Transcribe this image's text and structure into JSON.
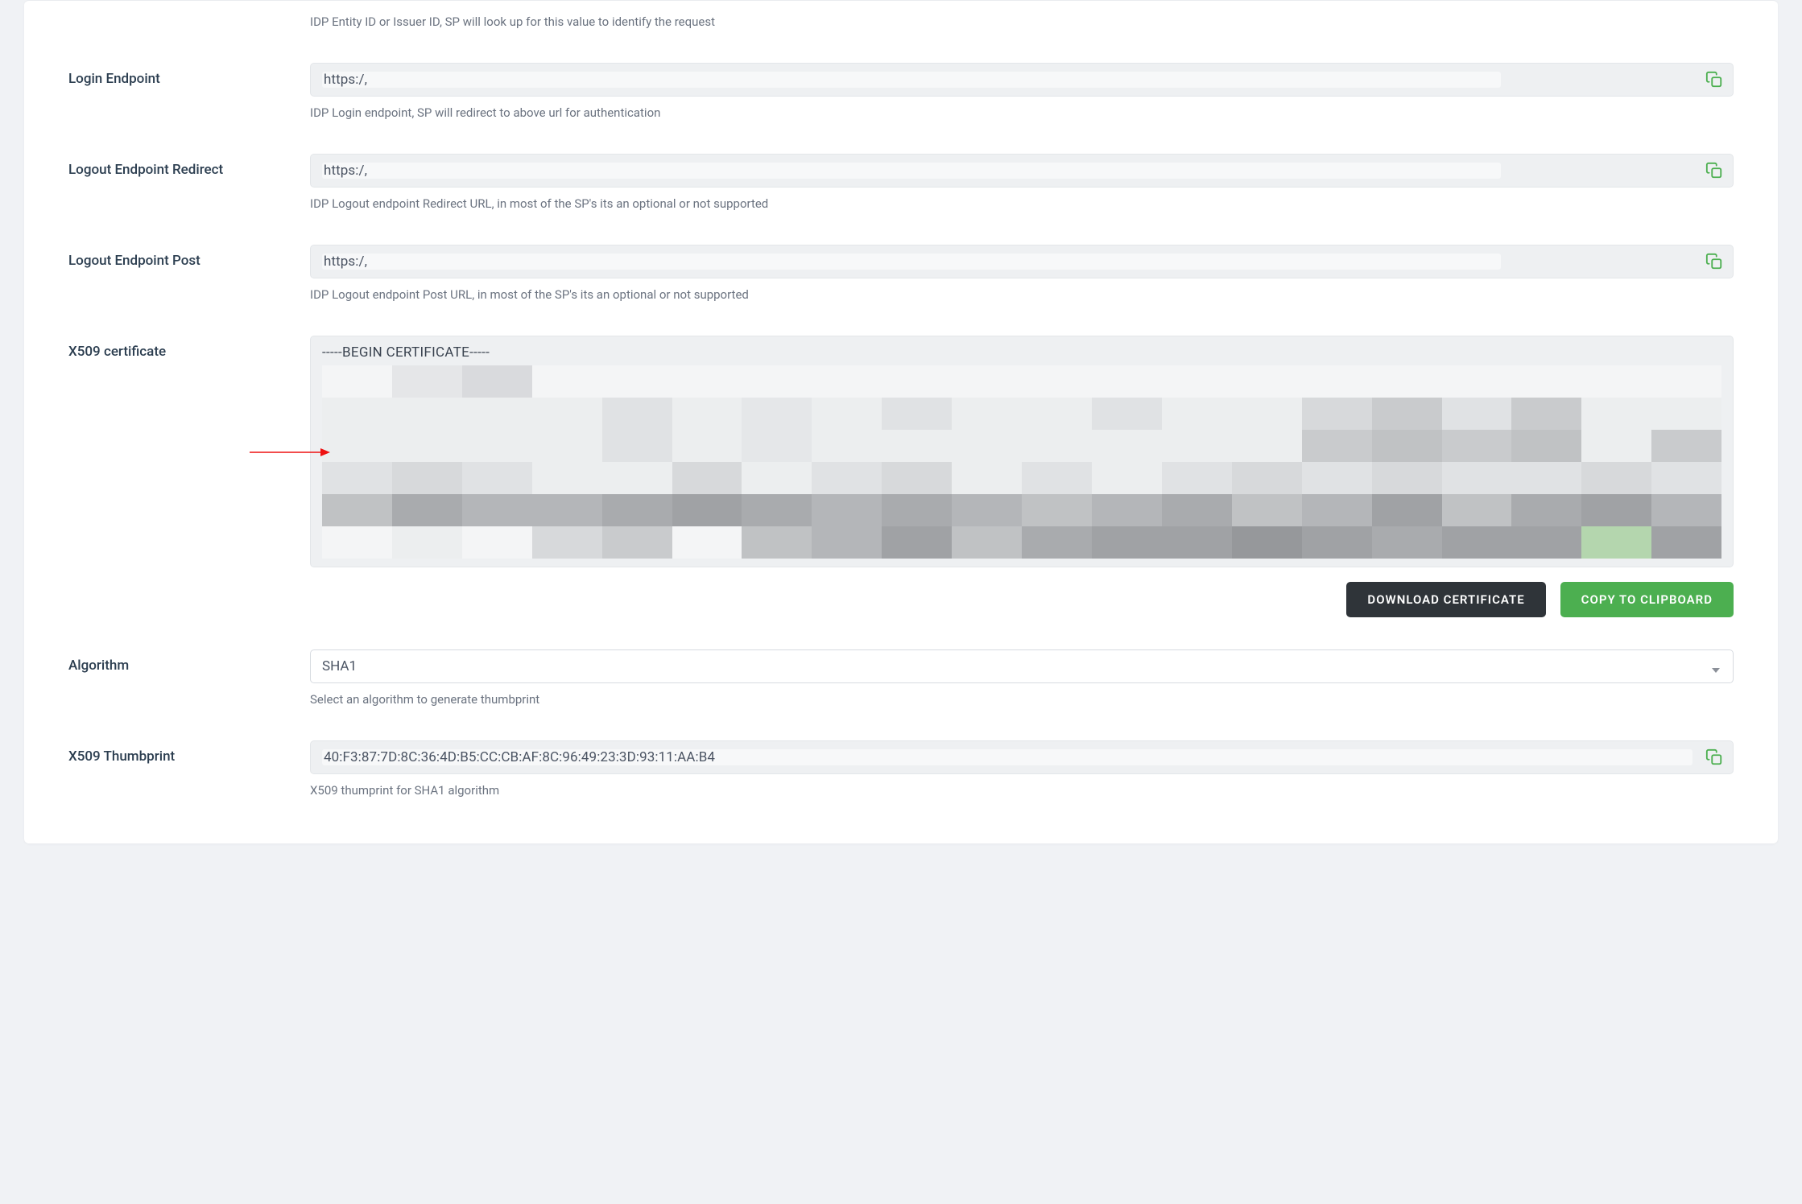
{
  "fields": {
    "entity_id": {
      "help": "IDP Entity ID or Issuer ID, SP will look up for this value to identify the request"
    },
    "login_endpoint": {
      "label": "Login Endpoint",
      "value": "https:/,",
      "help": "IDP Login endpoint, SP will redirect to above url for authentication"
    },
    "logout_redirect": {
      "label": "Logout Endpoint Redirect",
      "value": "https:/,",
      "help": "IDP Logout endpoint Redirect URL, in most of the SP's its an optional or not supported"
    },
    "logout_post": {
      "label": "Logout Endpoint Post",
      "value": "https:/,",
      "help": "IDP Logout endpoint Post URL, in most of the SP's its an optional or not supported"
    },
    "x509_cert": {
      "label": "X509 certificate",
      "header": "-----BEGIN CERTIFICATE-----"
    },
    "algorithm": {
      "label": "Algorithm",
      "value": "SHA1",
      "help": "Select an algorithm to generate thumbprint"
    },
    "x509_thumb": {
      "label": "X509 Thumbprint",
      "value": "40:F3:87:7D:8C:36:4D:B5:CC:CB:AF:8C:96:49:23:3D:93:11:AA:B4",
      "help": "X509 thumprint for SHA1 algorithm"
    }
  },
  "buttons": {
    "download_cert": "DOWNLOAD CERTIFICATE",
    "copy_clipboard": "COPY TO CLIPBOARD"
  },
  "pixel_rows": [
    [
      "#f4f5f6",
      "#e5e6e8",
      "#d9dadd",
      "#f4f5f6",
      "#f4f5f6",
      "#f4f5f6",
      "#f4f5f6",
      "#f4f5f6",
      "#f4f5f6",
      "#f4f5f6",
      "#f4f5f6",
      "#f4f5f6",
      "#f4f5f6",
      "#f4f5f6",
      "#f4f5f6",
      "#f4f5f6",
      "#f4f5f6",
      "#f4f5f6",
      "#f4f5f6",
      "#f4f5f6"
    ],
    [
      "#eceeef",
      "#eceeef",
      "#eceeef",
      "#eceeef",
      "#e0e2e4",
      "#eceeef",
      "#e5e7e9",
      "#eceeef",
      "#e0e2e4",
      "#eceeef",
      "#eceeef",
      "#e0e2e4",
      "#eceeef",
      "#eceeef",
      "#d7d9db",
      "#c9cbcd",
      "#e0e2e4",
      "#c9cbcd",
      "#eceeef",
      "#eceeef"
    ],
    [
      "#eceeef",
      "#eceeef",
      "#eceeef",
      "#eceeef",
      "#e0e2e4",
      "#eceeef",
      "#e5e7e9",
      "#eceeef",
      "#eceeef",
      "#eceeef",
      "#eceeef",
      "#eceeef",
      "#eceeef",
      "#eceeef",
      "#c9cbcd",
      "#c0c2c4",
      "#c9cbcd",
      "#c0c2c4",
      "#eceeef",
      "#c9cbcd"
    ],
    [
      "#e0e2e4",
      "#d7d9db",
      "#e0e2e4",
      "#eceeef",
      "#eceeef",
      "#d7d9db",
      "#eceeef",
      "#e0e2e4",
      "#d7d9db",
      "#eceeef",
      "#e0e2e4",
      "#eceeef",
      "#e0e2e4",
      "#d7d9db",
      "#e0e2e4",
      "#d7d9db",
      "#e0e2e4",
      "#e0e2e4",
      "#d7d9db",
      "#e0e2e4"
    ],
    [
      "#c0c2c4",
      "#a9abae",
      "#b4b6b9",
      "#b4b6b9",
      "#a9abae",
      "#a0a2a5",
      "#a9abae",
      "#b4b6b9",
      "#a9abae",
      "#b4b6b9",
      "#c0c2c4",
      "#b4b6b9",
      "#a9abae",
      "#c0c2c4",
      "#b4b6b9",
      "#a0a2a5",
      "#c0c2c4",
      "#a9abae",
      "#a0a2a5",
      "#b4b6b9"
    ],
    [
      "#f4f5f6",
      "#eceeef",
      "#f4f5f6",
      "#d7d9db",
      "#c9cbcd",
      "#f4f5f6",
      "#c0c2c4",
      "#b4b6b9",
      "#a0a2a5",
      "#c0c2c4",
      "#a9abae",
      "#a0a2a5",
      "#a0a2a5",
      "#96989b",
      "#a0a2a5",
      "#a9abae",
      "#a0a2a5",
      "#a0a2a5",
      "#b4d6ae",
      "#a0a2a5"
    ]
  ]
}
